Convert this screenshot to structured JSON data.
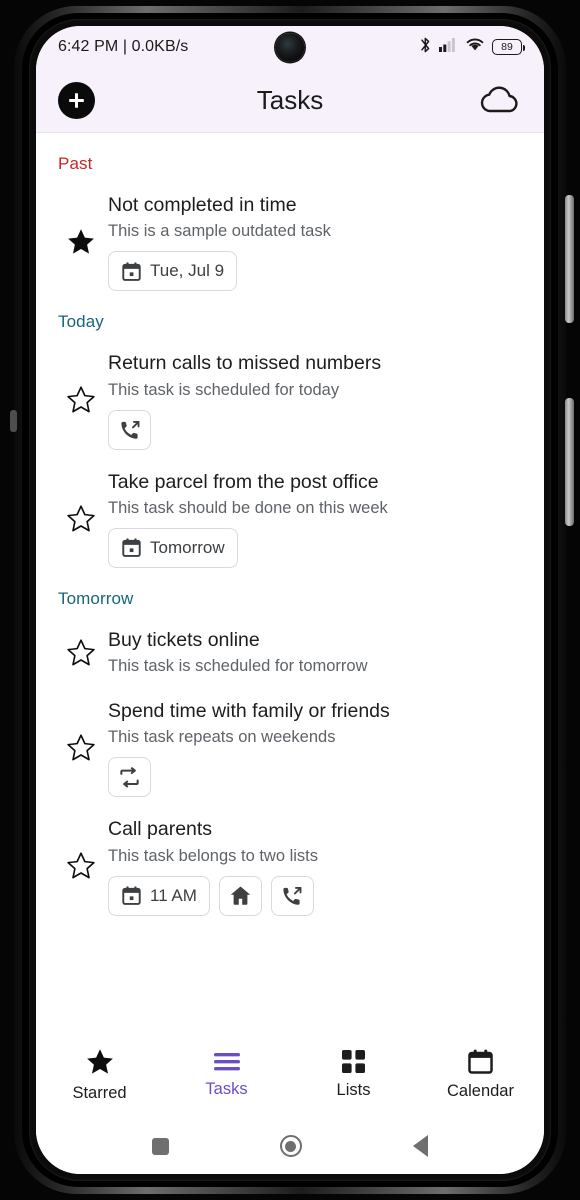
{
  "status_bar": {
    "time_and_rate": "6:42 PM | 0.0KB/s",
    "battery_level": "89",
    "icons": [
      "bluetooth-icon",
      "cellular-signal-icon",
      "wifi-icon",
      "battery-icon"
    ]
  },
  "app_bar": {
    "title": "Tasks",
    "add_label": "+",
    "add_icon": "plus-icon",
    "cloud_icon": "cloud-icon",
    "background": "#f7f1fb"
  },
  "colors": {
    "past_header": "#c62828",
    "today_header": "#19647e",
    "tomorrow_header": "#19647e",
    "active_tab": "#6b4ec2"
  },
  "sections": [
    {
      "label": "Past",
      "color": "#c62828",
      "tasks": [
        {
          "title": "Not completed in time",
          "description": "This is a sample outdated task",
          "starred": true,
          "star_icon": "star-filled-icon",
          "chips": [
            {
              "icon": "calendar-icon",
              "label": "Tue, Jul 9"
            }
          ]
        }
      ]
    },
    {
      "label": "Today",
      "color": "#19647e",
      "tasks": [
        {
          "title": "Return calls to missed numbers",
          "description": "This task is scheduled for today",
          "starred": false,
          "star_icon": "star-outline-icon",
          "chips": [
            {
              "icon": "outgoing-call-icon",
              "label": ""
            }
          ]
        },
        {
          "title": "Take parcel from the post office",
          "description": "This task should be done on this week",
          "starred": false,
          "star_icon": "star-outline-icon",
          "chips": [
            {
              "icon": "calendar-icon",
              "label": "Tomorrow"
            }
          ]
        }
      ]
    },
    {
      "label": "Tomorrow",
      "color": "#19647e",
      "tasks": [
        {
          "title": "Buy tickets online",
          "description": "This task is scheduled for tomorrow",
          "starred": false,
          "star_icon": "star-outline-icon",
          "chips": []
        },
        {
          "title": "Spend time with family or friends",
          "description": "This task repeats on weekends",
          "starred": false,
          "star_icon": "star-outline-icon",
          "chips": [
            {
              "icon": "repeat-icon",
              "label": ""
            }
          ]
        },
        {
          "title": "Call parents",
          "description": "This task belongs to two lists",
          "starred": false,
          "star_icon": "star-outline-icon",
          "chips": [
            {
              "icon": "calendar-icon",
              "label": "11 AM"
            },
            {
              "icon": "home-icon",
              "label": ""
            },
            {
              "icon": "outgoing-call-icon",
              "label": ""
            }
          ]
        }
      ]
    }
  ],
  "bottom_nav": {
    "items": [
      {
        "label": "Starred",
        "icon": "star-filled-icon",
        "active": false
      },
      {
        "label": "Tasks",
        "icon": "hamburger-lines-icon",
        "active": true
      },
      {
        "label": "Lists",
        "icon": "grid-squares-icon",
        "active": false
      },
      {
        "label": "Calendar",
        "icon": "calendar-icon",
        "active": false
      }
    ]
  },
  "system_nav": {
    "items": [
      "recents-square-icon",
      "home-circle-icon",
      "back-triangle-icon"
    ]
  }
}
